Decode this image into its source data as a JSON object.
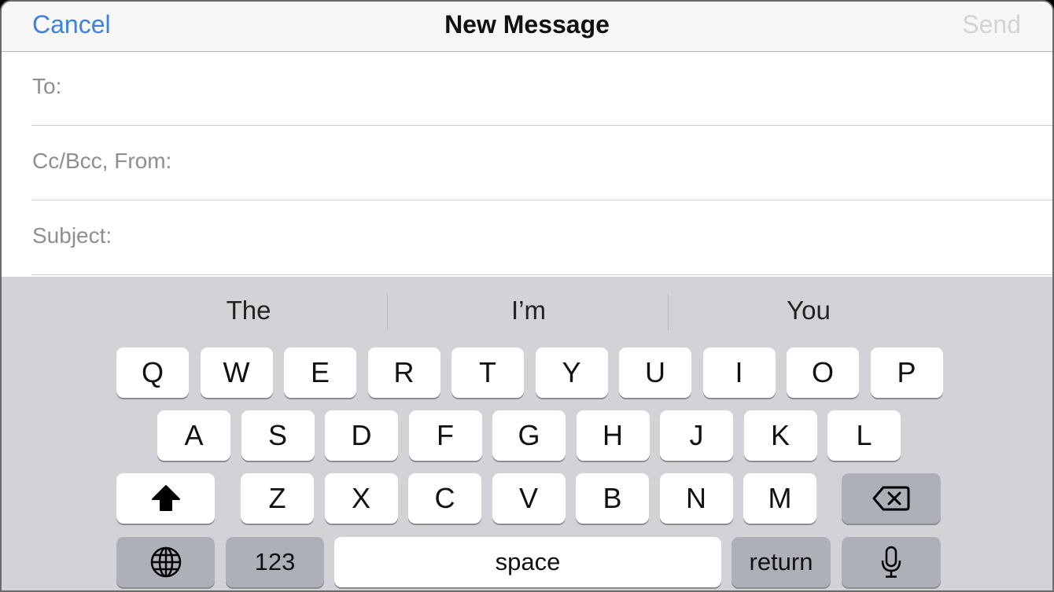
{
  "navbar": {
    "cancel_label": "Cancel",
    "title": "New Message",
    "send_label": "Send"
  },
  "fields": {
    "to_label": "To:",
    "ccbcc_label": "Cc/Bcc, From:",
    "subject_label": "Subject:"
  },
  "suggestions": [
    "The",
    "I’m",
    "You"
  ],
  "keyboard": {
    "row1": [
      "Q",
      "W",
      "E",
      "R",
      "T",
      "Y",
      "U",
      "I",
      "O",
      "P"
    ],
    "row2": [
      "A",
      "S",
      "D",
      "F",
      "G",
      "H",
      "J",
      "K",
      "L"
    ],
    "row3": [
      "Z",
      "X",
      "C",
      "V",
      "B",
      "N",
      "M"
    ],
    "numbers_label": "123",
    "space_label": "space",
    "return_label": "return",
    "icons": {
      "shift": "shift-icon",
      "delete": "delete-icon",
      "globe": "globe-icon",
      "mic": "microphone-icon"
    }
  },
  "colors": {
    "accent": "#3a82e0",
    "send_disabled": "#d4d4d4",
    "keyboard_bg": "#d2d3d7",
    "key_dark": "#adb0b8"
  }
}
